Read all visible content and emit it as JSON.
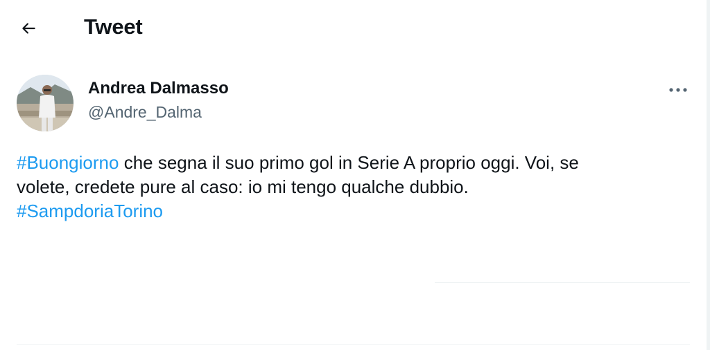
{
  "header": {
    "back_icon": "arrow-left-icon",
    "title": "Tweet"
  },
  "tweet": {
    "author": {
      "name": "Andrea Dalmasso",
      "handle": "@Andre_Dalma",
      "avatar": "user-avatar-photo"
    },
    "more_icon": "more-horizontal-icon",
    "text": {
      "hashtag1": "#Buongiorno",
      "line1_rest": " che segna il suo primo gol in Serie A proprio oggi. Voi, se",
      "line2": "volete, credete pure al caso: io mi tengo qualche dubbio.",
      "hashtag2": "#SampdoriaTorino"
    }
  },
  "colors": {
    "link": "#1d9bf0",
    "text": "#0f1419",
    "secondary": "#536471",
    "divider": "#eff3f4"
  }
}
